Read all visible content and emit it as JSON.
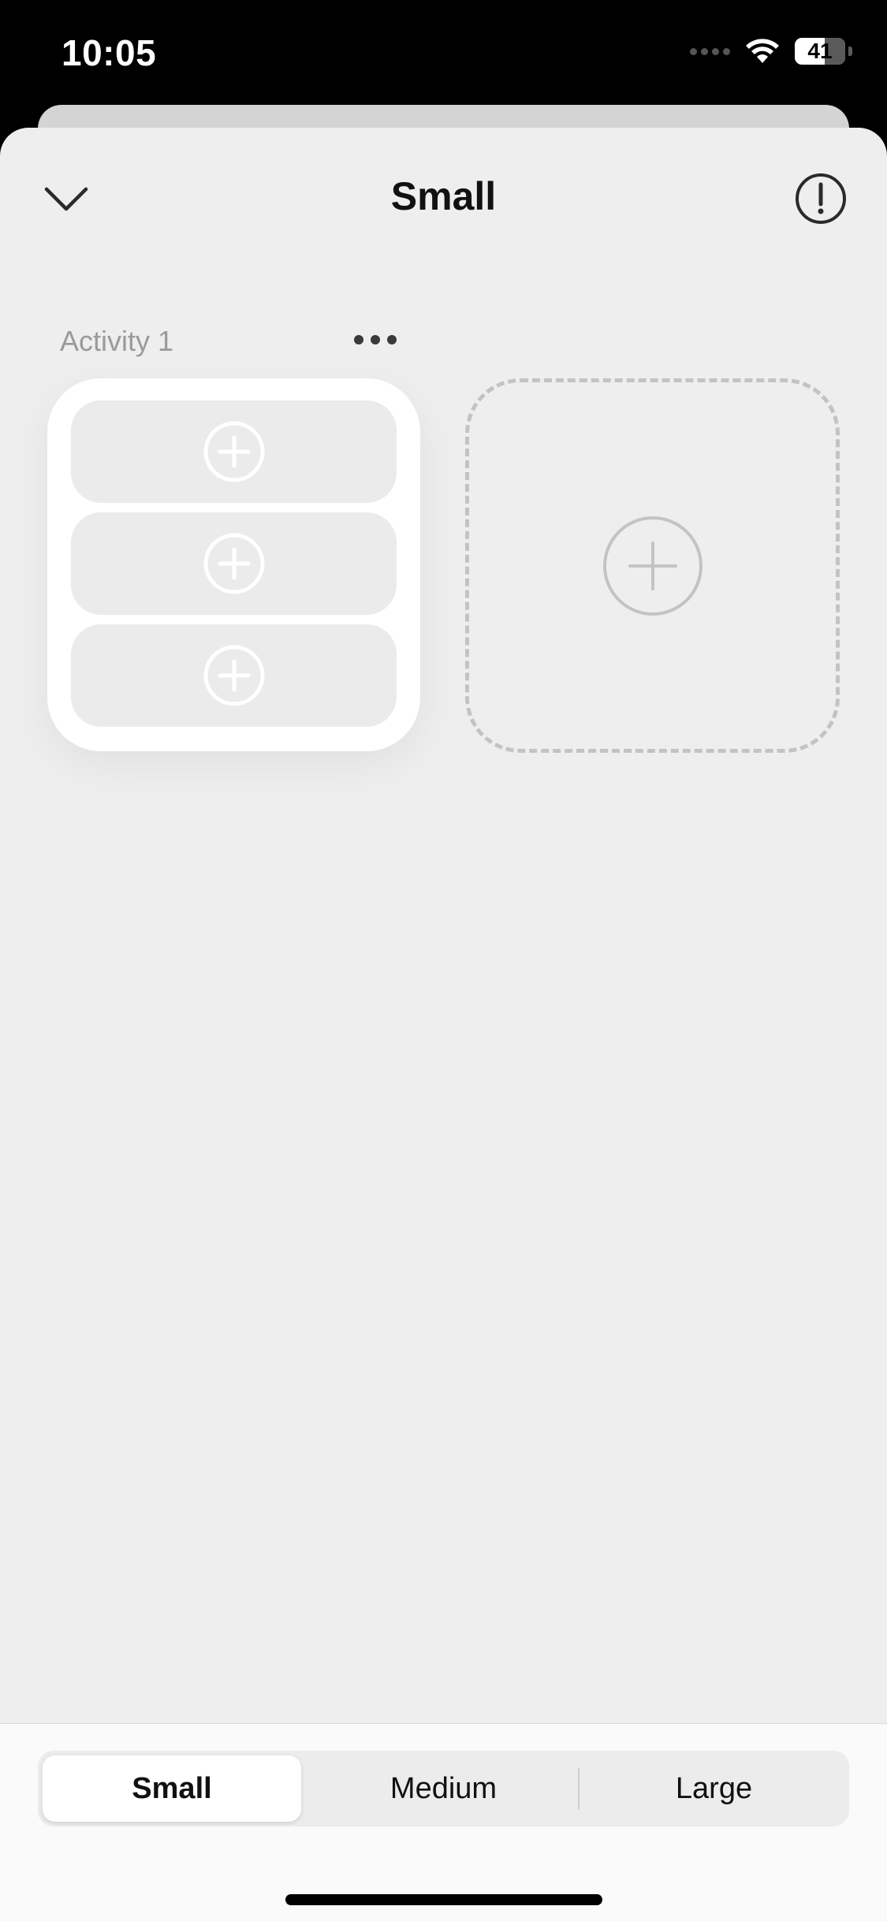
{
  "status_bar": {
    "time": "10:05",
    "battery": "41"
  },
  "header": {
    "title": "Small",
    "collapse_icon": "chevron-down-icon",
    "info_icon": "exclamation-circle-icon"
  },
  "activity": {
    "label": "Activity 1",
    "more_icon": "ellipsis-icon",
    "slots": [
      {
        "icon": "plus-circle-icon"
      },
      {
        "icon": "plus-circle-icon"
      },
      {
        "icon": "plus-circle-icon"
      }
    ]
  },
  "add_widget": {
    "icon": "plus-circle-icon"
  },
  "size_tabs": {
    "options": [
      "Small",
      "Medium",
      "Large"
    ],
    "selected": "Small"
  },
  "colors": {
    "sheet_background": "#eeeeee",
    "card_background": "#ffffff",
    "slot_background": "#ebebeb",
    "dashed_border": "#c3c3c3",
    "muted_text": "#9a9a9a"
  }
}
